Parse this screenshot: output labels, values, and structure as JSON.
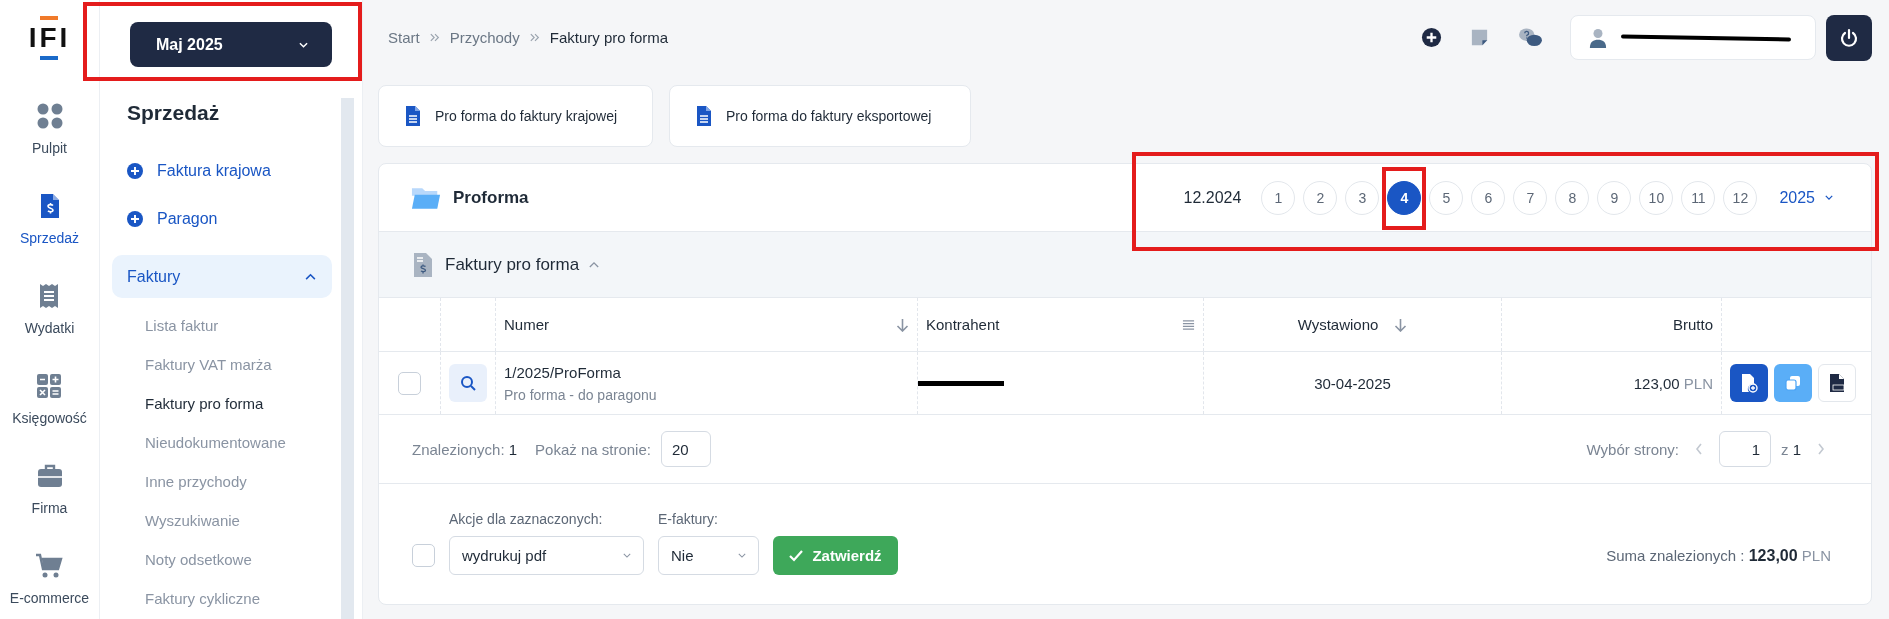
{
  "rail": {
    "logo": "IFI",
    "items": [
      {
        "label": "Pulpit",
        "selected": false
      },
      {
        "label": "Sprzedaż",
        "selected": true
      },
      {
        "label": "Wydatki",
        "selected": false
      },
      {
        "label": "Księgowość",
        "selected": false
      },
      {
        "label": "Firma",
        "selected": false
      },
      {
        "label": "E-commerce",
        "selected": false
      }
    ]
  },
  "month_selector": {
    "label": "Maj 2025",
    "highlighted": true
  },
  "sidebar": {
    "title": "Sprzedaż",
    "quick_actions": [
      "Faktura krajowa",
      "Paragon"
    ],
    "groups": [
      {
        "label": "Faktury",
        "expanded": true,
        "children": [
          {
            "label": "Lista faktur",
            "selected": false
          },
          {
            "label": "Faktury VAT marża",
            "selected": false
          },
          {
            "label": "Faktury pro forma",
            "selected": true
          },
          {
            "label": "Nieudokumentowane",
            "selected": false
          },
          {
            "label": "Inne przychody",
            "selected": false
          },
          {
            "label": "Wyszukiwanie",
            "selected": false
          },
          {
            "label": "Noty odsetkowe",
            "selected": false
          },
          {
            "label": "Faktury cykliczne",
            "selected": false
          }
        ]
      }
    ]
  },
  "breadcrumbs": [
    {
      "label": "Start",
      "current": false
    },
    {
      "label": "Przychody",
      "current": false
    },
    {
      "label": "Faktury pro forma",
      "current": true
    }
  ],
  "create_buttons": [
    "Pro forma do faktury krajowej",
    "Pro forma do faktury eksportowej"
  ],
  "panel": {
    "title": "Proforma",
    "period_label": "12.2024",
    "months_highlighted": true,
    "year": "2025",
    "months": [
      {
        "label": "1",
        "selected": false,
        "highlighted": false
      },
      {
        "label": "2",
        "selected": false,
        "highlighted": false
      },
      {
        "label": "3",
        "selected": false,
        "highlighted": false
      },
      {
        "label": "4",
        "selected": true,
        "highlighted": true
      },
      {
        "label": "5",
        "selected": false,
        "highlighted": false
      },
      {
        "label": "6",
        "selected": false,
        "highlighted": false
      },
      {
        "label": "7",
        "selected": false,
        "highlighted": false
      },
      {
        "label": "8",
        "selected": false,
        "highlighted": false
      },
      {
        "label": "9",
        "selected": false,
        "highlighted": false
      },
      {
        "label": "10",
        "selected": false,
        "highlighted": false
      },
      {
        "label": "11",
        "selected": false,
        "highlighted": false
      },
      {
        "label": "12",
        "selected": false,
        "highlighted": false
      }
    ]
  },
  "section": {
    "title": "Faktury pro forma",
    "expanded": true
  },
  "table": {
    "columns": [
      {
        "label": "Numer",
        "kind": "sort"
      },
      {
        "label": "Kontrahent",
        "kind": "menu"
      },
      {
        "label": "Wystawiono",
        "kind": "sort-center"
      },
      {
        "label": "Brutto",
        "kind": "right"
      }
    ],
    "rows": [
      {
        "checked": false,
        "number": "1/2025/ProForma",
        "description": "Pro forma - do paragonu",
        "date": "30-04-2025",
        "amount": "123,00",
        "currency": "PLN"
      }
    ]
  },
  "footer": {
    "found_label": "Znalezionych:",
    "found": "1",
    "per_page_label": "Pokaż na stronie:",
    "per_page": "20",
    "page_label": "Wybór strony:",
    "page": "1",
    "of_label": "z",
    "pages": "1"
  },
  "bulk": {
    "checked": false,
    "action_label": "Akcje dla zaznaczonych:",
    "action": "wydrukuj pdf",
    "efaktury_label": "E-faktury:",
    "efaktury": "Nie",
    "submit": "Zatwierdź",
    "sum_label": "Suma znalezionych :",
    "sum": "123,00",
    "currency": "PLN"
  }
}
